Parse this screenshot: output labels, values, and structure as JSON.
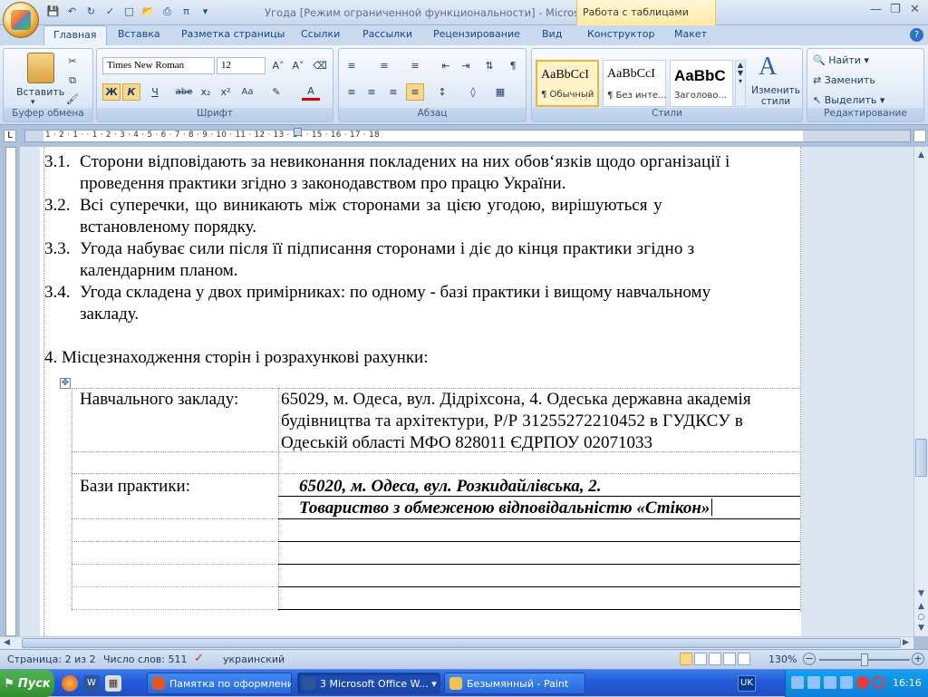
{
  "window": {
    "title": "Угода [Режим ограниченной функциональности] - Microso...",
    "contextual_tab_group": "Работа с таблицами"
  },
  "tabs": [
    {
      "label": "Главная"
    },
    {
      "label": "Вставка"
    },
    {
      "label": "Разметка страницы"
    },
    {
      "label": "Ссылки"
    },
    {
      "label": "Рассылки"
    },
    {
      "label": "Рецензирование"
    },
    {
      "label": "Вид"
    },
    {
      "label": "Конструктор"
    },
    {
      "label": "Макет"
    }
  ],
  "ribbon": {
    "clipboard": {
      "label": "Буфер обмена",
      "paste": "Вставить"
    },
    "font": {
      "label": "Шрифт",
      "font_name": "Times New Roman",
      "font_size": "12"
    },
    "paragraph": {
      "label": "Абзац"
    },
    "styles": {
      "label": "Стили",
      "items": [
        {
          "preview": "AaBbCcI",
          "name": "¶ Обычный"
        },
        {
          "preview": "AaBbCcI",
          "name": "¶ Без инте..."
        },
        {
          "preview": "AaBbC",
          "name": "Заголово..."
        }
      ],
      "change_styles": "Изменить стили"
    },
    "editing": {
      "label": "Редактирование",
      "find": "Найти",
      "replace": "Заменить",
      "select": "Выделить"
    }
  },
  "ruler": {
    "h_numbers": "1 · 2 · 1 · · 1 · 2 · 3 · 4 · 5 · 6 · 7 · 8 · 9 · 10 · 11 · 12 · 13 · 14 · 15 · 16 · 17 · 18"
  },
  "document": {
    "items": [
      {
        "num": "3.1.",
        "l1": "Сторони відповідають за невиконання покладених на них обов‘язків щодо організації і",
        "l2": "проведення практики згідно з законодавством про працю  України."
      },
      {
        "num": "3.2.",
        "l1": "Всі   суперечки,   що   виникають   між   сторонами   за   цією   угодою,   вирішуються   у",
        "l2": "встановленому порядку."
      },
      {
        "num": "3.3.",
        "l1": "Угода набуває сили після її підписання сторонами і діє до кінця практики згідно з",
        "l2": "календарним планом."
      },
      {
        "num": "3.4.",
        "l1": "Угода складена у двох примірниках: по одному - базі практики і вищому навчальному",
        "l2": "закладу."
      }
    ],
    "section4": "4.   Місцезнаходження сторін і розрахункові рахунки:",
    "table": {
      "row1_label": "Навчального  закладу:",
      "row1_lines": [
        "65029, м. Одеса, вул. Дідріхсона, 4. Одеська державна академія",
        "будівництва та архітектури, Р/Р 31255272210452 в ГУДКСУ в",
        "Одеській області МФО 828011 ЄДРПОУ 02071033"
      ],
      "row2_label": "Бази практики:",
      "row2_line1": "65020, м. Одеса, вул. Розкидайлівська, 2.",
      "row2_line2": "Товариство з обмеженою відповідальністю «Стікон»"
    }
  },
  "status": {
    "page": "Страница: 2 из 2",
    "words": "Число слов: 511",
    "language": "украинский",
    "zoom": "130%"
  },
  "taskbar": {
    "start": "Пуск",
    "tasks": [
      {
        "label": "Памятка по оформлени..."
      },
      {
        "label": "3 Microsoft Office W..."
      },
      {
        "label": "Безымянный - Paint"
      }
    ],
    "lang": "UK",
    "clock": "16:16"
  },
  "colors": {
    "ribbon_accent": "#15428b",
    "taskbar_blue": "#245edb",
    "start_green": "#3c9a3c"
  }
}
